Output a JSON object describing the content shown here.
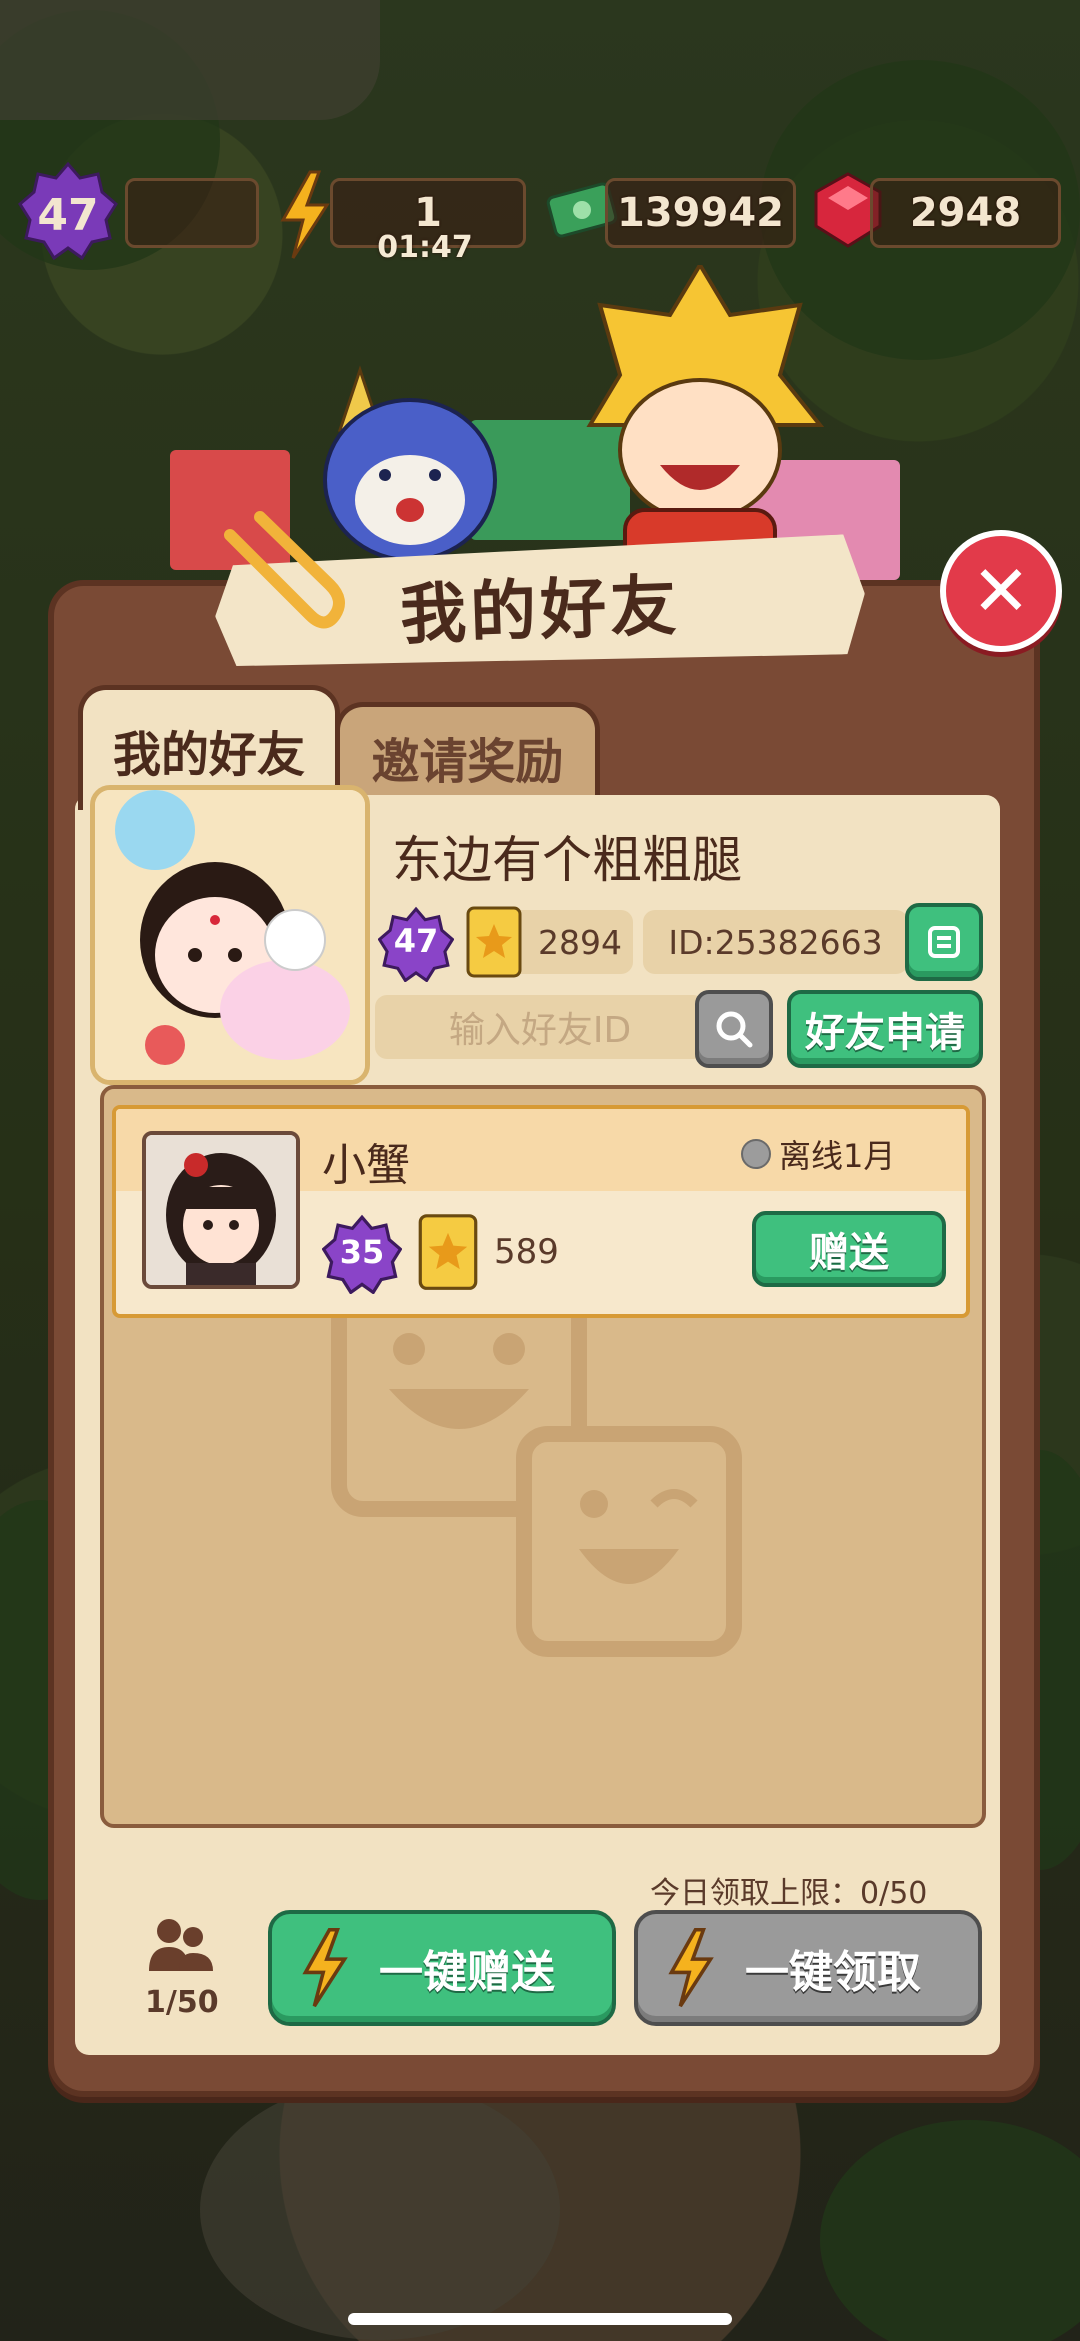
{
  "top_bar": {
    "level": "47",
    "energy": "1",
    "energy_timer": "01:47",
    "cash": "139942",
    "gems": "2948"
  },
  "dialog": {
    "title": "我的好友",
    "close_icon": "close-icon"
  },
  "tabs": [
    {
      "label": "我的好友",
      "active": true
    },
    {
      "label": "邀请奖励",
      "active": false
    }
  ],
  "profile": {
    "name": "东边有个粗粗腿",
    "level": "47",
    "stars": "2894",
    "id": "ID:25382663",
    "search_placeholder": "输入好友ID",
    "friend_request_label": "好友申请"
  },
  "friends": [
    {
      "name": "小蟹",
      "status": "离线1月",
      "level": "35",
      "stars": "589",
      "gift_label": "赠送"
    }
  ],
  "footer": {
    "daily_limit": "今日领取上限：0/50",
    "friend_count": "1/50",
    "send_all_label": "一键赠送",
    "claim_all_label": "一键领取"
  },
  "colors": {
    "panel": "#7a4a35",
    "panel_inner": "#f2e2c2",
    "green_button": "#3fc07e",
    "grey_button": "#9a9a9a",
    "close_button": "#e23a4a",
    "level_badge": "#8a44c8"
  }
}
